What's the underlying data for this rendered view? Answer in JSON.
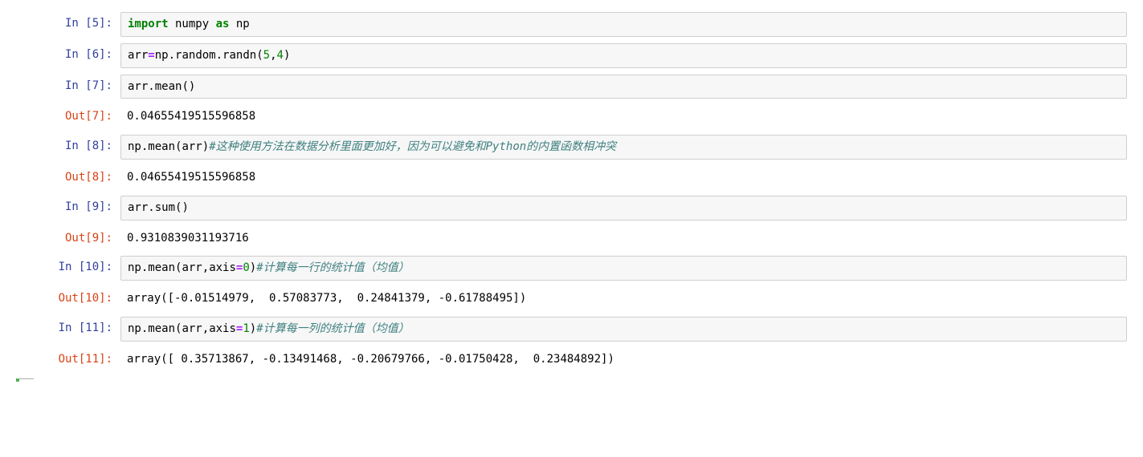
{
  "cells": [
    {
      "in_prompt": "In  [5]:",
      "out_prompt": "",
      "output": ""
    },
    {
      "in_prompt": "In  [6]:",
      "out_prompt": "",
      "output": ""
    },
    {
      "in_prompt": "In  [7]:",
      "out_prompt": "Out[7]:",
      "output": "0.04655419515596858"
    },
    {
      "in_prompt": "In  [8]:",
      "out_prompt": "Out[8]:",
      "output": "0.04655419515596858"
    },
    {
      "in_prompt": "In  [9]:",
      "out_prompt": "Out[9]:",
      "output": "0.9310839031193716"
    },
    {
      "in_prompt": "In [10]:",
      "out_prompt": "Out[10]:",
      "output": "array([-0.01514979,  0.57083773,  0.24841379, -0.61788495])"
    },
    {
      "in_prompt": "In [11]:",
      "out_prompt": "Out[11]:",
      "output": "array([ 0.35713867, -0.13491468, -0.20679766, -0.01750428,  0.23484892])"
    }
  ],
  "code": {
    "c5_import": "import",
    "c5_numpy": " numpy ",
    "c5_as": "as",
    "c5_np": " np",
    "c6_arr": "arr",
    "c6_eq": "=",
    "c6_np": "np",
    "c6_dot1": ".",
    "c6_random": "random",
    "c6_dot2": ".",
    "c6_randn": "randn",
    "c6_open": "(",
    "c6_five": "5",
    "c6_comma": ",",
    "c6_four": "4",
    "c6_close": ")",
    "c7_arr": "arr",
    "c7_dot": ".",
    "c7_mean": "mean",
    "c7_open": "(",
    "c7_close": ")",
    "c8_np": "np",
    "c8_dot": ".",
    "c8_mean": "mean",
    "c8_open": "(",
    "c8_arr": "arr",
    "c8_close": ")",
    "c8_comment": "#这种使用方法在数据分析里面更加好，因为可以避免和Python的内置函数相冲突",
    "c9_arr": "arr",
    "c9_dot": ".",
    "c9_sum": "sum",
    "c9_open": "(",
    "c9_close": ")",
    "c10_np": "np",
    "c10_dot": ".",
    "c10_mean": "mean",
    "c10_open": "(",
    "c10_arr": "arr",
    "c10_comma": ",",
    "c10_axis": "axis",
    "c10_eq": "=",
    "c10_zero": "0",
    "c10_close": ")",
    "c10_comment": "#计算每一行的统计值（均值）",
    "c11_np": "np",
    "c11_dot": ".",
    "c11_mean": "mean",
    "c11_open": "(",
    "c11_arr": "arr",
    "c11_comma": ",",
    "c11_axis": "axis",
    "c11_eq": "=",
    "c11_one": "1",
    "c11_close": ")",
    "c11_comment": "#计算每一列的统计值（均值）"
  }
}
